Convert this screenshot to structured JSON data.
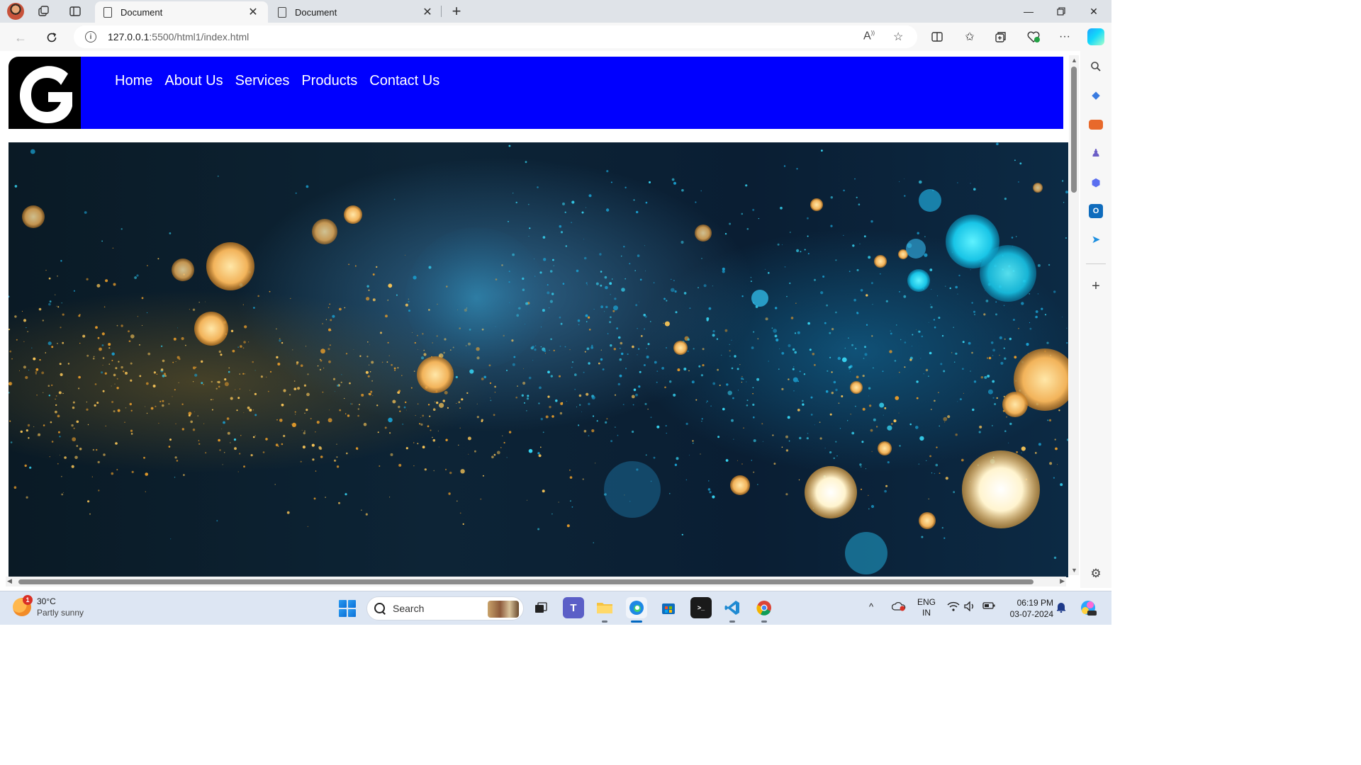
{
  "browser": {
    "tabs": [
      {
        "title": "Document",
        "active": true
      },
      {
        "title": "Document",
        "active": false
      }
    ],
    "url_host": "127.0.0.1",
    "url_rest": ":5500/html1/index.html",
    "icons": {
      "profile": "avatar-icon",
      "workspaces": "workspaces-icon",
      "tab_actions": "tab-actions-icon",
      "new_tab": "plus-icon",
      "back": "back-arrow-icon",
      "refresh": "refresh-icon",
      "site_info": "info-icon",
      "read_aloud": "read-aloud-icon",
      "favorite": "star-icon",
      "split_screen": "split-screen-icon",
      "favorites": "favorites-icon",
      "collections": "collections-icon",
      "browser_essentials": "heart-pulse-icon",
      "more": "ellipsis-icon",
      "copilot": "copilot-icon"
    }
  },
  "site": {
    "nav": [
      {
        "label": "Home"
      },
      {
        "label": "About Us"
      },
      {
        "label": "Services"
      },
      {
        "label": "Products"
      },
      {
        "label": "Contact Us"
      }
    ],
    "logo_letter": "G",
    "header_color": "#0000ff",
    "hero_image": "gold and blue bokeh glitter"
  },
  "sidebar": {
    "icons": [
      "search-icon",
      "shopping-tag-icon",
      "tools-icon",
      "games-icon",
      "microsoft365-icon",
      "outlook-icon",
      "drop-icon",
      "add-icon",
      "settings-icon"
    ]
  },
  "taskbar": {
    "weather": {
      "temp": "30°C",
      "condition": "Partly sunny",
      "badge": "1"
    },
    "search_placeholder": "Search",
    "apps": [
      "task-view-icon",
      "teams-icon",
      "file-explorer-icon",
      "edge-icon",
      "store-icon",
      "terminal-icon",
      "vscode-icon",
      "chrome-icon"
    ],
    "tray": {
      "language": "ENG",
      "region": "IN"
    },
    "clock": {
      "time": "06:19 PM",
      "date": "03-07-2024"
    }
  }
}
